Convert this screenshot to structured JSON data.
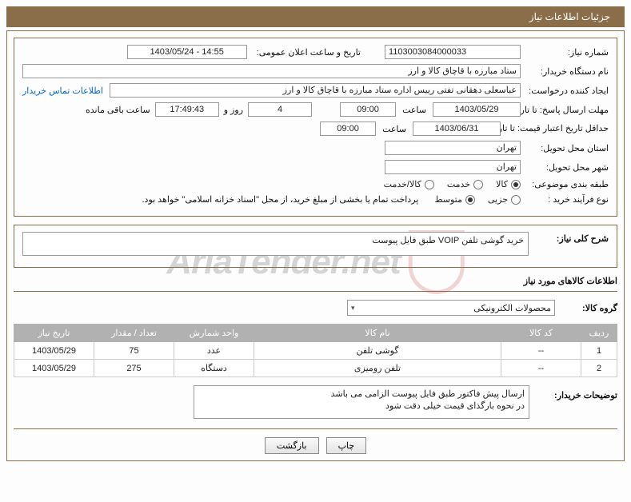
{
  "title": "جزئیات اطلاعات نیاز",
  "labels": {
    "need_no": "شماره نیاز:",
    "announce_dt": "تاریخ و ساعت اعلان عمومی:",
    "buyer_org": "نام دستگاه خریدار:",
    "requester": "ایجاد کننده درخواست:",
    "contact_link": "اطلاعات تماس خریدار",
    "resp_deadline": "مهلت ارسال پاسخ: تا تاریخ:",
    "time": "ساعت",
    "days_and": "روز و",
    "remaining": "ساعت باقی مانده",
    "price_valid": "حداقل تاریخ اعتبار قیمت: تا تاریخ:",
    "deliv_prov": "استان محل تحویل:",
    "deliv_city": "شهر محل تحویل:",
    "subject_cat": "طبقه بندی موضوعی:",
    "buy_type": "نوع فرآیند خرید :",
    "payment_note": "پرداخت تمام یا بخشی از مبلغ خرید، از محل \"اسناد خزانه اسلامی\" خواهد بود.",
    "general_desc": "شرح کلی نیاز:",
    "goods_info": "اطلاعات کالاهای مورد نیاز",
    "goods_group": "گروه کالا:",
    "buyer_note": "توضیحات خریدار:"
  },
  "fields": {
    "need_no": "1103003084000033",
    "announce_dt": "1403/05/24 - 14:55",
    "buyer_org": "ستاد مبارزه با قاچاق کالا و ارز",
    "requester": "عباسعلی  دهقانی تفتی رییس اداره ستاد مبارزه با قاچاق کالا و ارز",
    "resp_date": "1403/05/29",
    "resp_time": "09:00",
    "days_remaining": "4",
    "time_remaining": "17:49:43",
    "valid_date": "1403/06/31",
    "valid_time": "09:00",
    "province": "تهران",
    "city": "تهران",
    "general_desc": "خرید گوشی تلفن VOIP طبق فایل پیوست",
    "goods_group": "محصولات الکترونیکی",
    "buyer_note": "ارسال پیش فاکتور طبق فایل پیوست الزامی می باشد\nدر نحوه بارگذای قیمت خیلی دقت شود"
  },
  "radios": {
    "subject": {
      "kala": "کالا",
      "khedmat": "خدمت",
      "kala_khedmat": "کالا/خدمت",
      "selected": "kala"
    },
    "buy_type": {
      "jozi": "جزیی",
      "motavaset": "متوسط",
      "selected": "motavaset"
    }
  },
  "table": {
    "headers": {
      "row": "ردیف",
      "code": "کد کالا",
      "name": "نام کالا",
      "unit": "واحد شمارش",
      "qty": "تعداد / مقدار",
      "date": "تاریخ نیاز"
    },
    "rows": [
      {
        "no": "1",
        "code": "--",
        "name": "گوشی تلفن",
        "unit": "عدد",
        "qty": "75",
        "date": "1403/05/29"
      },
      {
        "no": "2",
        "code": "--",
        "name": "تلفن رومیزی",
        "unit": "دستگاه",
        "qty": "275",
        "date": "1403/05/29"
      }
    ]
  },
  "buttons": {
    "print": "چاپ",
    "back": "بازگشت"
  },
  "watermark": "AriaTender.net"
}
